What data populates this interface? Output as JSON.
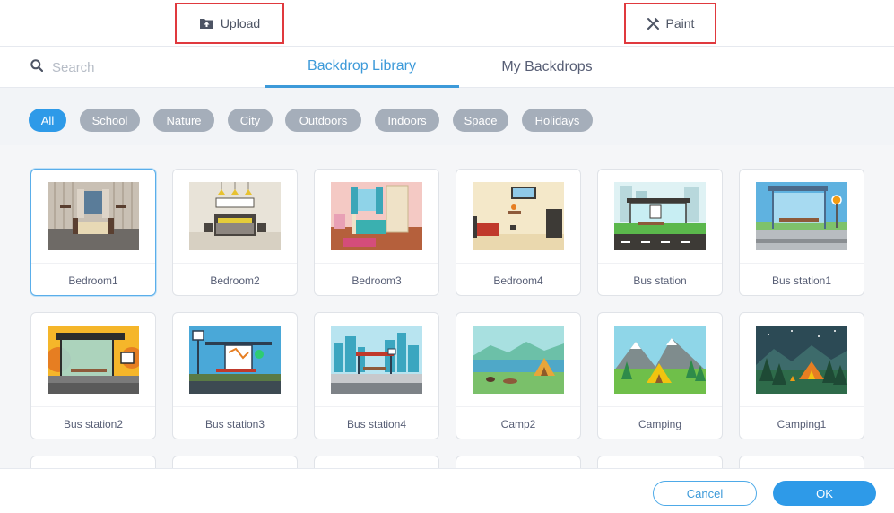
{
  "toolbar": {
    "upload_label": "Upload",
    "upload_icon": "upload-icon",
    "paint_label": "Paint",
    "paint_icon": "paint-brush-icon"
  },
  "search": {
    "placeholder": "Search",
    "icon": "search-icon"
  },
  "tabs": [
    {
      "label": "Backdrop Library",
      "active": true
    },
    {
      "label": "My Backdrops",
      "active": false
    }
  ],
  "filters": [
    "All",
    "School",
    "Nature",
    "City",
    "Outdoors",
    "Indoors",
    "Space",
    "Holidays"
  ],
  "active_filter": "All",
  "backdrops": [
    {
      "name": "Bedroom1",
      "selected": true
    },
    {
      "name": "Bedroom2"
    },
    {
      "name": "Bedroom3"
    },
    {
      "name": "Bedroom4"
    },
    {
      "name": "Bus station"
    },
    {
      "name": "Bus station1"
    },
    {
      "name": "Bus station2"
    },
    {
      "name": "Bus station3"
    },
    {
      "name": "Bus station4"
    },
    {
      "name": "Camp2"
    },
    {
      "name": "Camping"
    },
    {
      "name": "Camping1"
    }
  ],
  "footer": {
    "cancel_label": "Cancel",
    "ok_label": "OK"
  },
  "colors": {
    "accent": "#2e9ae8",
    "pill_inactive": "#a5aeba",
    "highlight_border": "#e0393e"
  }
}
